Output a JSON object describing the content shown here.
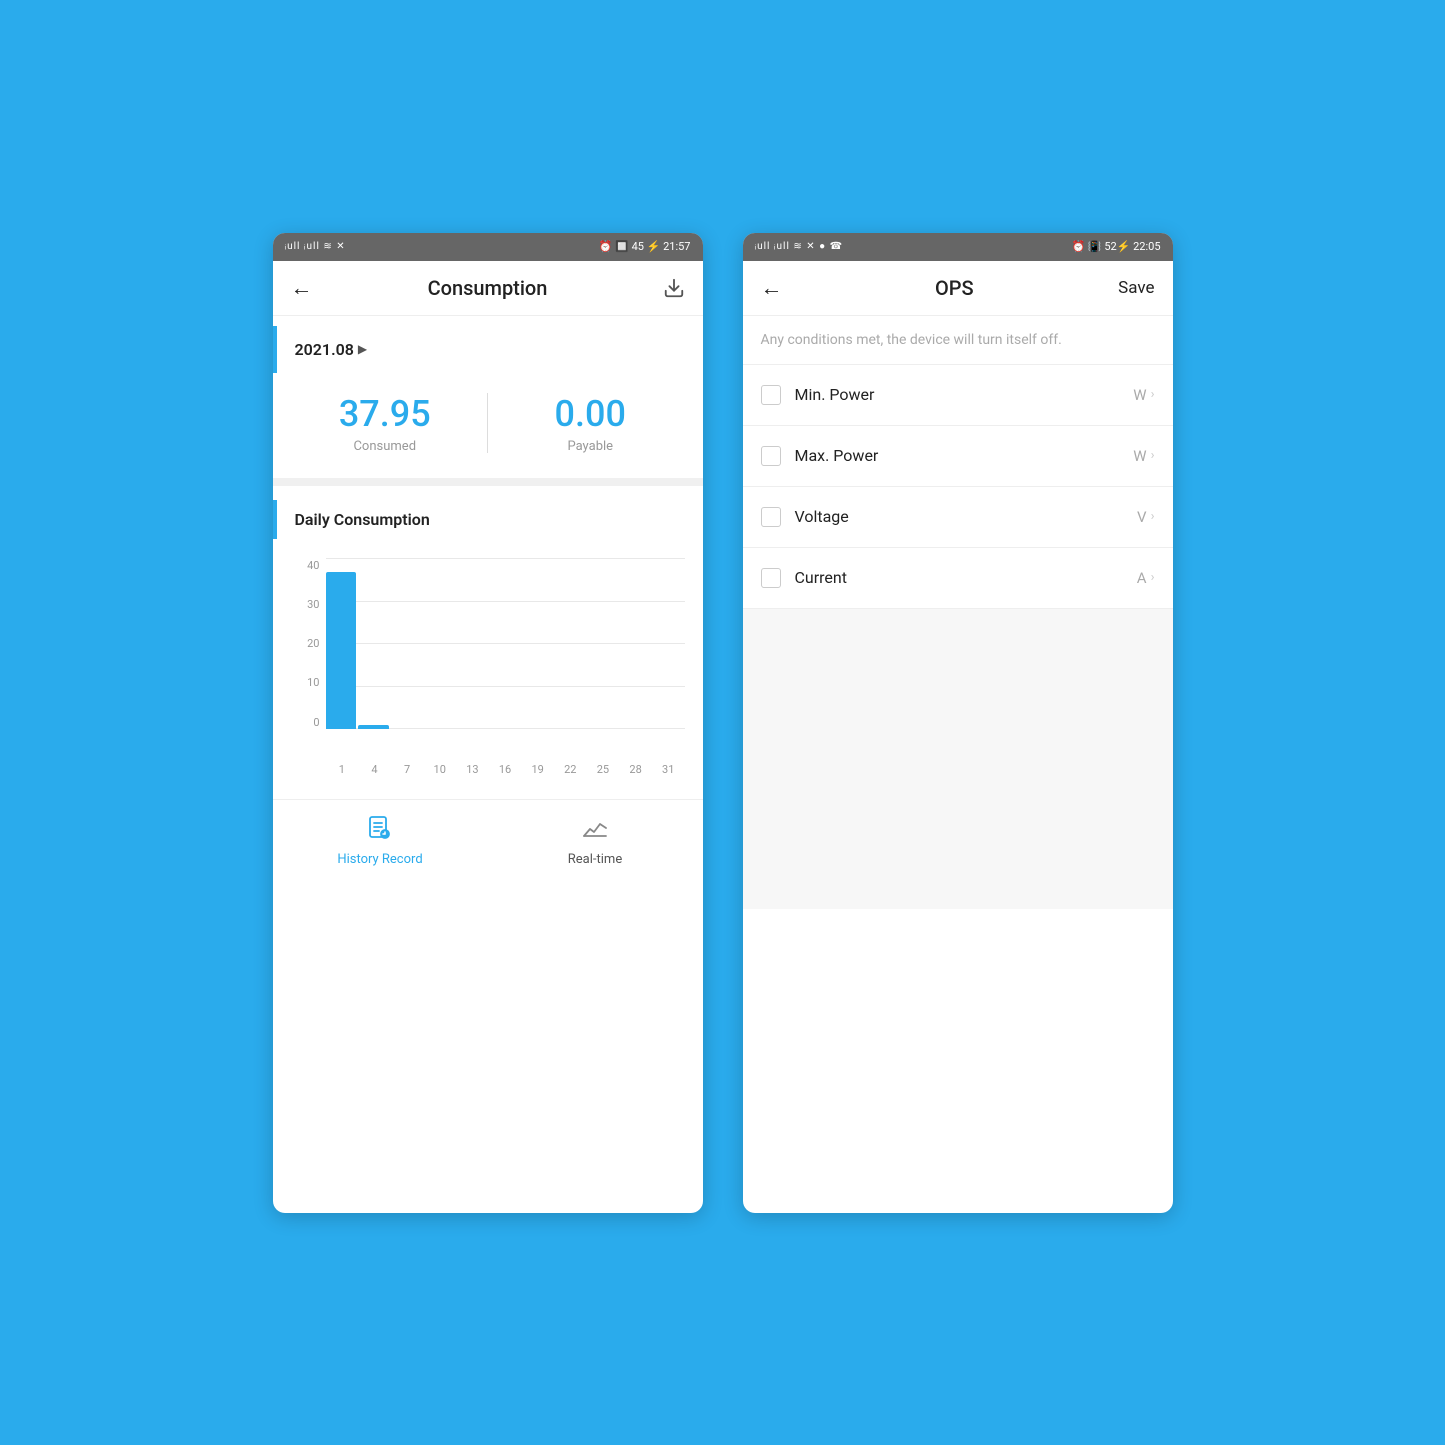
{
  "left_phone": {
    "status_bar": {
      "left": "ᵉull ⁴⁶ull ⊕ ✕",
      "right": "⏰ 🔲 45 ⚡ 21:57"
    },
    "nav": {
      "back_label": "←",
      "title": "Consumption",
      "download_icon": "download"
    },
    "month": {
      "text": "2021.08",
      "arrow": "▶"
    },
    "stats": {
      "consumed_value": "37.95",
      "consumed_label": "Consumed",
      "payable_value": "0.00",
      "payable_label": "Payable"
    },
    "daily_section": {
      "title": "Daily Consumption"
    },
    "chart": {
      "y_labels": [
        "0",
        "10",
        "20",
        "30",
        "40"
      ],
      "x_labels": [
        "1",
        "4",
        "7",
        "10",
        "13",
        "16",
        "19",
        "22",
        "25",
        "28",
        "31"
      ],
      "bars": [
        37,
        1,
        0,
        0,
        0,
        0,
        0,
        0,
        0,
        0,
        0
      ],
      "max_value": 40
    },
    "tabs": [
      {
        "id": "history",
        "label": "History Record",
        "active": true
      },
      {
        "id": "realtime",
        "label": "Real-time",
        "active": false
      }
    ]
  },
  "right_phone": {
    "status_bar": {
      "left": "ᵉull ⁴⁶ull ⊕ ✕ ● ☎",
      "right": "⏰ 🔲 52 ⚡ 22:05"
    },
    "nav": {
      "back_label": "←",
      "title": "OPS",
      "save_label": "Save"
    },
    "description": "Any conditions met, the device will turn itself off.",
    "items": [
      {
        "id": "min-power",
        "label": "Min. Power",
        "unit": "W"
      },
      {
        "id": "max-power",
        "label": "Max. Power",
        "unit": "W"
      },
      {
        "id": "voltage",
        "label": "Voltage",
        "unit": "V"
      },
      {
        "id": "current",
        "label": "Current",
        "unit": "A"
      }
    ]
  }
}
